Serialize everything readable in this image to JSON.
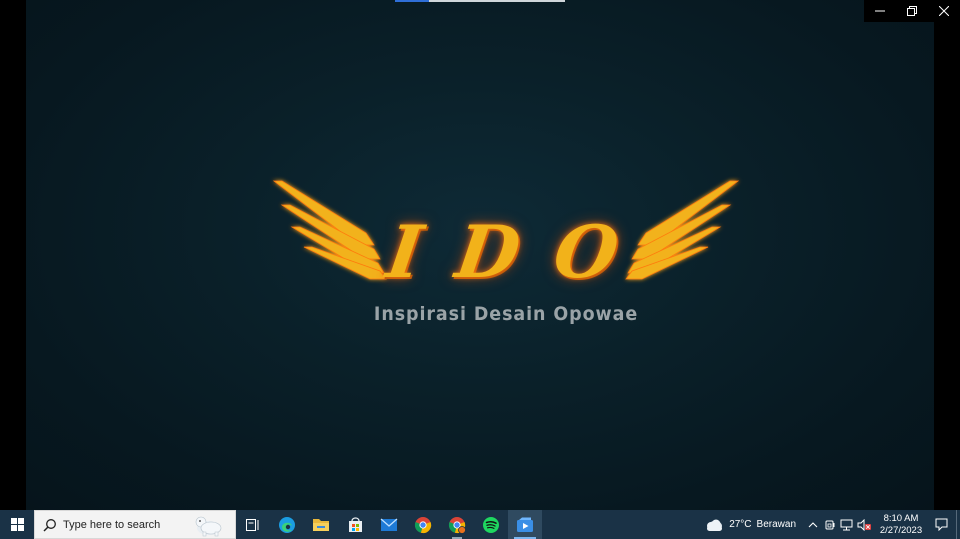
{
  "viewer": {
    "progress_fraction": 0.2,
    "accent_color": "#2f6fd8"
  },
  "window_controls": {
    "minimize_icon": "minimize-icon",
    "restore_icon": "restore-icon",
    "close_icon": "close-icon"
  },
  "logo": {
    "letters": [
      "I",
      "D",
      "O"
    ],
    "tagline": "Inspirasi Desain Opowae",
    "color": "#f2b21a"
  },
  "taskbar": {
    "search_placeholder": "Type here to search",
    "apps": [
      {
        "name": "task-view",
        "icon": "task-view-icon"
      },
      {
        "name": "edge",
        "icon": "edge-icon"
      },
      {
        "name": "file-explorer",
        "icon": "folder-icon"
      },
      {
        "name": "microsoft-store",
        "icon": "store-icon"
      },
      {
        "name": "mail",
        "icon": "mail-icon"
      },
      {
        "name": "chrome",
        "icon": "chrome-icon"
      },
      {
        "name": "chrome-profile",
        "icon": "chrome-profile-icon"
      },
      {
        "name": "spotify",
        "icon": "spotify-icon"
      },
      {
        "name": "media-player",
        "icon": "media-player-icon"
      }
    ],
    "weather": {
      "temp": "27°C",
      "condition": "Berawan"
    },
    "clock": {
      "time": "8:10 AM",
      "date": "2/27/2023"
    }
  }
}
